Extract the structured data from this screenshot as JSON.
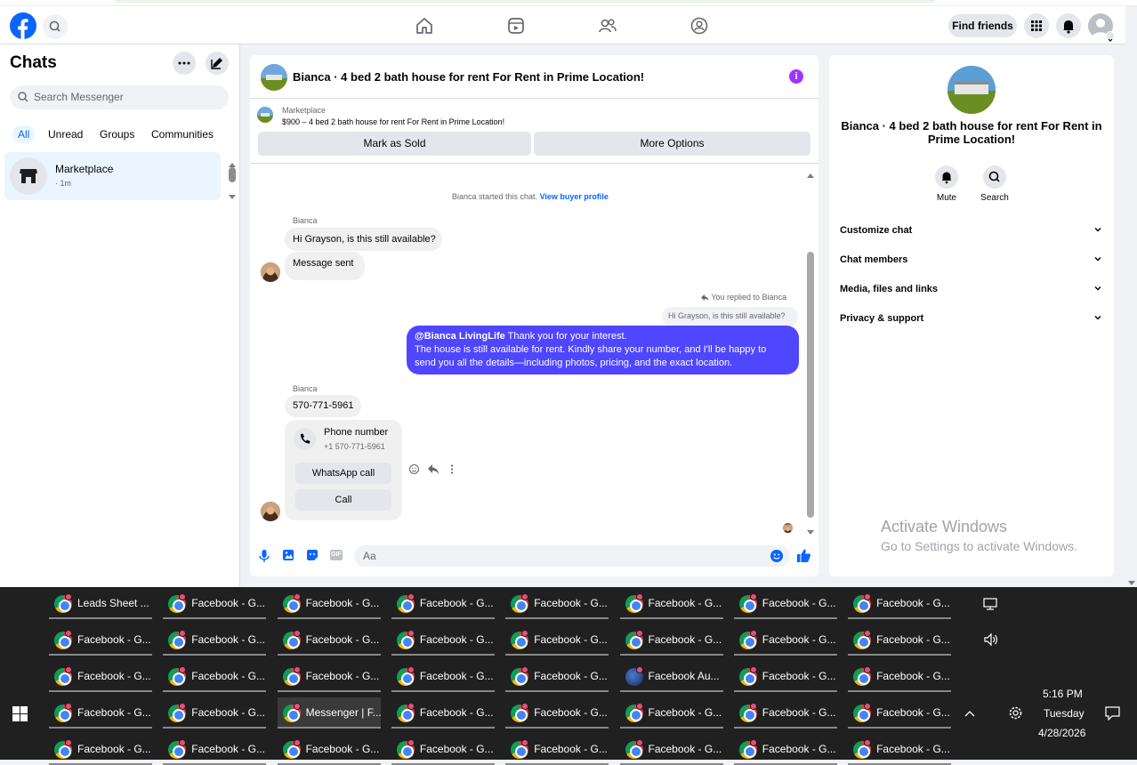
{
  "topbar": {
    "find_friends": "Find friends"
  },
  "sidebar": {
    "title": "Chats",
    "search_placeholder": "Search Messenger",
    "tabs": [
      "All",
      "Unread",
      "Groups",
      "Communities"
    ],
    "chat_item": {
      "name": "Marketplace",
      "time": "· 1m"
    }
  },
  "conversation": {
    "title": "Bianca · 4 bed 2 bath house for rent For Rent in Prime Location!",
    "listing_label": "Marketplace",
    "listing_detail": "$900 – 4 bed 2 bath house for rent For Rent in Prime Location!",
    "mark_sold": "Mark as Sold",
    "more_options": "More Options",
    "started_text": "Bianca started this chat.",
    "view_profile": "View buyer profile",
    "sender1": "Bianca",
    "msg1": "Hi Grayson, is this still available?",
    "msg2": "Message sent",
    "replied_label": "You replied to Bianca",
    "quoted": "Hi Grayson, is this still available?",
    "my_mention": "@Bianca LivingLife",
    "my_text1": " Thank you for your interest.",
    "my_text2": "The house is still available for rent. Kindly share your number, and I'll be happy to",
    "my_text3": "send you all the details—including photos, pricing, and the exact location.",
    "sender2": "Bianca",
    "phone_msg": "570-771-5961",
    "card_title": "Phone number",
    "card_sub": "+1 570-771-5961",
    "whatsapp": "WhatsApp call",
    "call": "Call",
    "composer_placeholder": "Aa"
  },
  "right_panel": {
    "title": "Bianca · 4 bed 2 bath house for rent For Rent in Prime Location!",
    "mute": "Mute",
    "search": "Search",
    "rows": [
      "Customize chat",
      "Chat members",
      "Media, files and links",
      "Privacy & support"
    ]
  },
  "watermark": {
    "line1": "Activate Windows",
    "line2": "Go to Settings to activate Windows."
  },
  "taskbar": {
    "rows": [
      [
        "Leads Sheet ...",
        "Facebook - G...",
        "Facebook - G...",
        "Facebook - G...",
        "Facebook - G...",
        "Facebook - G...",
        "Facebook - G...",
        "Facebook - G..."
      ],
      [
        "Facebook - G...",
        "Facebook - G...",
        "Facebook - G...",
        "Facebook - G...",
        "Facebook - G...",
        "Facebook - G...",
        "Facebook - G...",
        "Facebook - G..."
      ],
      [
        "Facebook - G...",
        "Facebook - G...",
        "Facebook - G...",
        "Facebook - G...",
        "Facebook - G...",
        "Facebook Au...",
        "Facebook - G...",
        "Facebook - G..."
      ],
      [
        "Facebook - G...",
        "Facebook - G...",
        "Messenger | F...",
        "Facebook - G...",
        "Facebook - G...",
        "Facebook - G...",
        "Facebook - G...",
        "Facebook - G..."
      ],
      [
        "Facebook - G...",
        "Facebook - G...",
        "Facebook - G...",
        "Facebook - G...",
        "Facebook - G...",
        "Facebook - G...",
        "Facebook - G...",
        "Facebook - G..."
      ]
    ],
    "time": "5:16 PM",
    "day": "Tuesday",
    "date": "4/28/2026"
  }
}
